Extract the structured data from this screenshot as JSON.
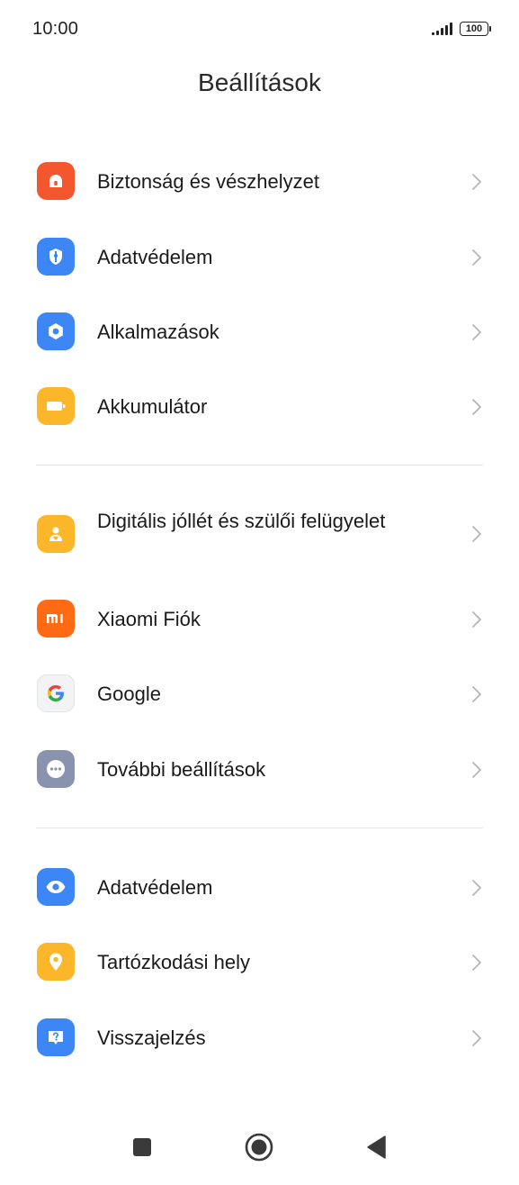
{
  "status_bar": {
    "time": "10:00",
    "battery": "100"
  },
  "header": {
    "title": "Beállítások"
  },
  "sections": [
    {
      "items": [
        {
          "label": "Biztonság és vészhelyzet",
          "icon": "emergency-icon",
          "color": "#F4572E"
        },
        {
          "label": "Adatvédelem",
          "icon": "privacy-shield-icon",
          "color": "#3D86F5"
        },
        {
          "label": "Alkalmazások",
          "icon": "apps-hexagon-icon",
          "color": "#3D86F5"
        },
        {
          "label": "Akkumulátor",
          "icon": "battery-icon",
          "color": "#FBB62A"
        }
      ]
    },
    {
      "items": [
        {
          "label": "Digitális jóllét és szülői felügyelet",
          "icon": "wellbeing-icon",
          "color": "#FBB62A"
        },
        {
          "label": "Xiaomi Fiók",
          "icon": "xiaomi-mi-icon",
          "color": "#FF6A13"
        },
        {
          "label": "Google",
          "icon": "google-g-icon",
          "color": "#F1F3F4"
        },
        {
          "label": "További beállítások",
          "icon": "more-dots-icon",
          "color": "#8A93AD"
        }
      ]
    },
    {
      "items": [
        {
          "label": "Adatvédelem",
          "icon": "eye-icon",
          "color": "#3D86F5"
        },
        {
          "label": "Tartózkodási hely",
          "icon": "location-pin-icon",
          "color": "#FBB62A"
        },
        {
          "label": "Visszajelzés",
          "icon": "feedback-question-icon",
          "color": "#3D86F5"
        }
      ]
    }
  ],
  "nav_bar": {
    "recents": "recents-square-icon",
    "home": "home-circle-icon",
    "back": "back-triangle-icon"
  }
}
